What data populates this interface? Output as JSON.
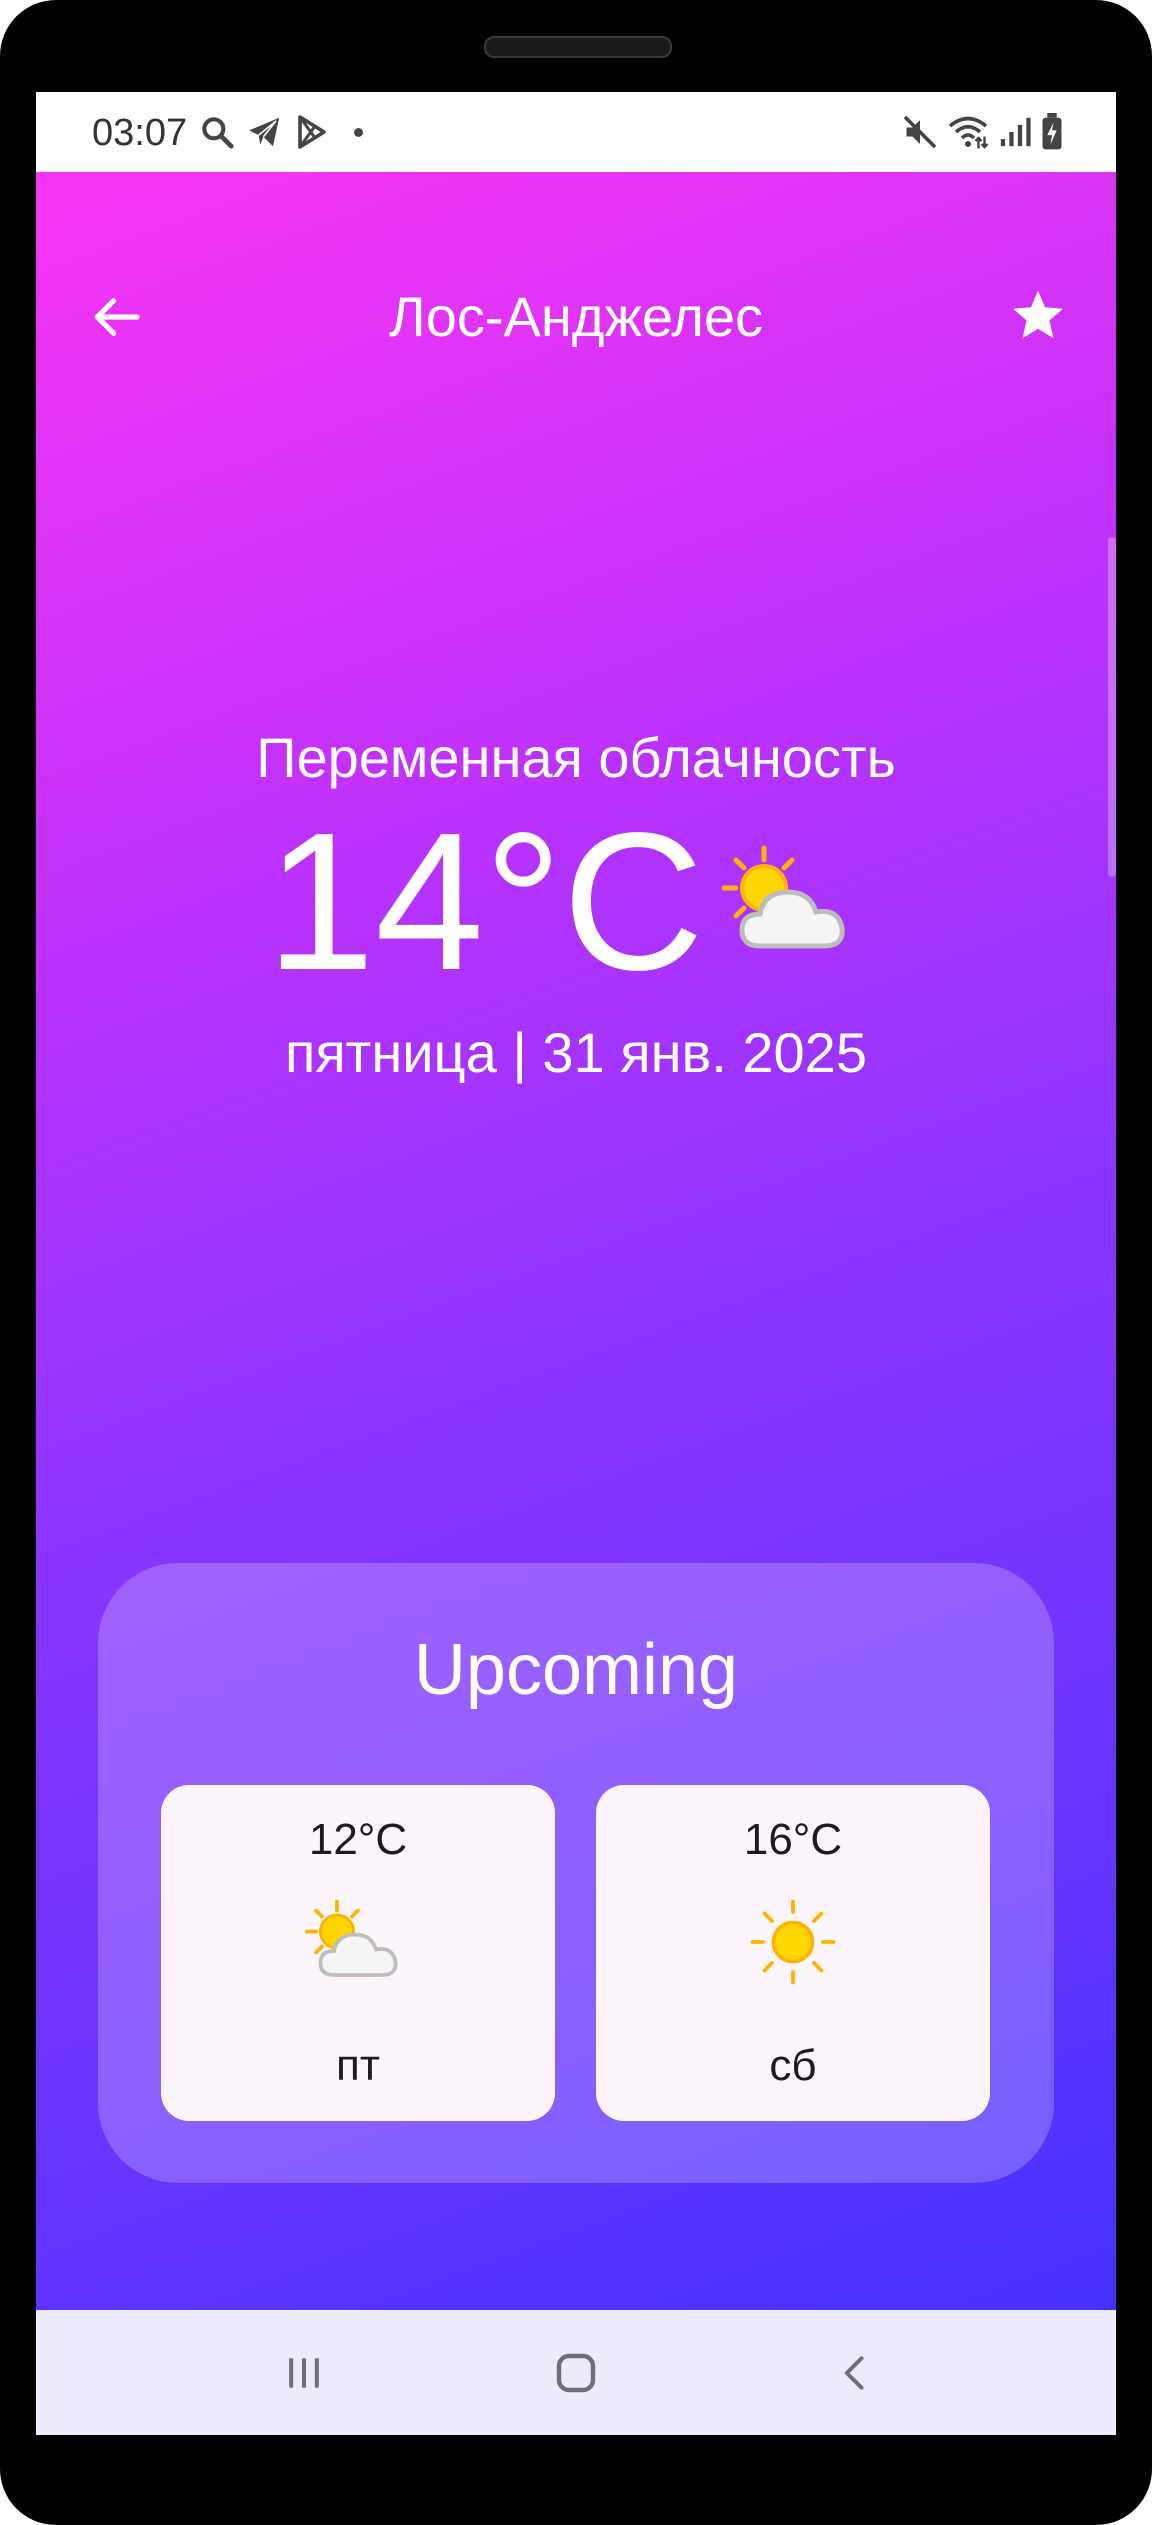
{
  "status_bar": {
    "time": "03:07",
    "left_icons": [
      "search-icon",
      "telegram-icon",
      "play-store-icon",
      "dot-icon"
    ],
    "right_icons": [
      "mute-icon",
      "wifi-icon",
      "signal-icon",
      "battery-charging-icon"
    ]
  },
  "header": {
    "city": "Лос-Анджелес",
    "back_icon": "arrow-back-icon",
    "favorite_icon": "star-icon"
  },
  "current": {
    "condition": "Переменная облачность",
    "temperature": "14°C",
    "icon": "partly-cloudy-icon",
    "date": "пятница | 31 янв. 2025"
  },
  "upcoming": {
    "title": "Upcoming",
    "items": [
      {
        "temperature": "12°C",
        "icon": "partly-cloudy-icon",
        "day": "пт"
      },
      {
        "temperature": "16°C",
        "icon": "sun-icon",
        "day": "сб"
      }
    ]
  },
  "nav_bar": {
    "buttons": [
      "recent-apps-icon",
      "home-icon",
      "back-icon"
    ]
  },
  "colors": {
    "gradient_start": "#f935f5",
    "gradient_mid": "#8a35ff",
    "gradient_end": "#4531ff",
    "card_background": "#fcf5fc",
    "navbar_background": "#ecebfb"
  }
}
